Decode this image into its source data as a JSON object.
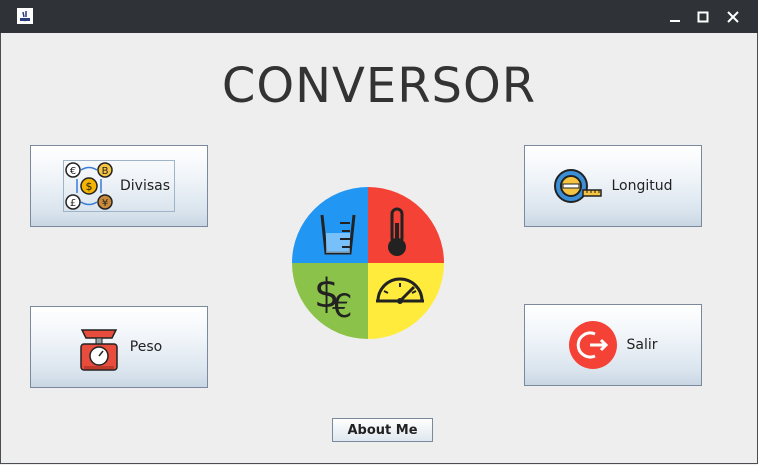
{
  "window": {
    "app_icon": "java-app-icon",
    "controls": [
      "minimize-icon",
      "maximize-icon",
      "close-icon"
    ]
  },
  "main": {
    "title": "CONVERSOR"
  },
  "buttons": {
    "divisas": {
      "label": "Divisas",
      "icon": "currency-exchange-icon"
    },
    "longitud": {
      "label": "Longitud",
      "icon": "tape-measure-icon"
    },
    "peso": {
      "label": "Peso",
      "icon": "scale-icon"
    },
    "salir": {
      "label": "Salir",
      "icon": "exit-icon"
    },
    "about": {
      "label": "About Me"
    }
  },
  "logo": {
    "icon": "converter-wheel-icon",
    "colors": {
      "blue": "#2196f3",
      "red": "#f44336",
      "green": "#8bc34a",
      "yellow": "#ffeb3b"
    }
  }
}
